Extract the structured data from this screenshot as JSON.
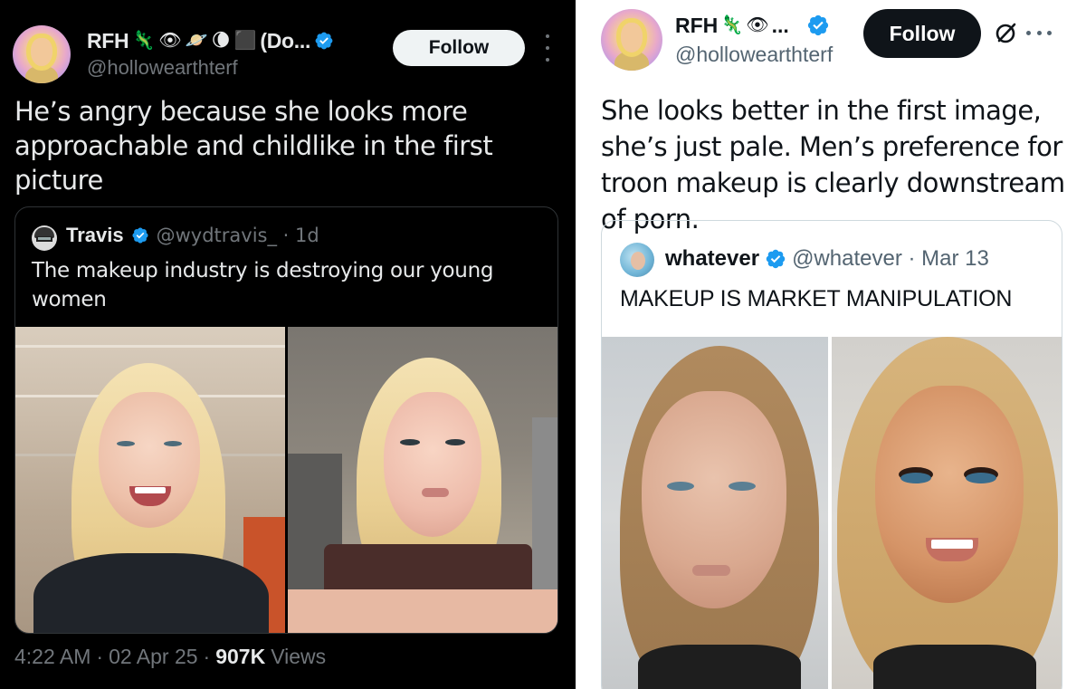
{
  "left_tweet": {
    "author_name": "RFH",
    "author_name_suffix": "(Do...",
    "emojis": [
      "🦎",
      "👁",
      "🪐",
      "🌘",
      "⬛"
    ],
    "handle": "@hollowearthterf",
    "follow_label": "Follow",
    "text": "He’s angry because she looks more approachable and childlike in the first picture",
    "quoted": {
      "author_name": "Travis",
      "handle_time": "@wydtravis_ · 1d",
      "text": "The makeup industry is destroying our young women"
    },
    "meta": {
      "time": "4:22 AM",
      "date": "02 Apr 25",
      "sep": "·",
      "views_count": "907K",
      "views_label": "Views"
    }
  },
  "right_tweet": {
    "author_name": "RFH",
    "author_name_suffix": "...",
    "emojis": [
      "🦎",
      "👁"
    ],
    "handle": "@hollowearthterf",
    "follow_label": "Follow",
    "text": "She looks better in the first image, she’s just pale. Men’s preference for troon makeup is clearly downstream of porn.",
    "quoted": {
      "author_name": "whatever",
      "handle_time": "@whatever · Mar 13",
      "text": "MAKEUP IS MARKET MANIPULATION"
    }
  },
  "colors": {
    "verified_blue": "#1d9bf0",
    "dark_bg": "#000000",
    "light_bg": "#ffffff"
  },
  "icons": [
    "verified-badge-icon",
    "more-options-icon",
    "grok-icon"
  ]
}
